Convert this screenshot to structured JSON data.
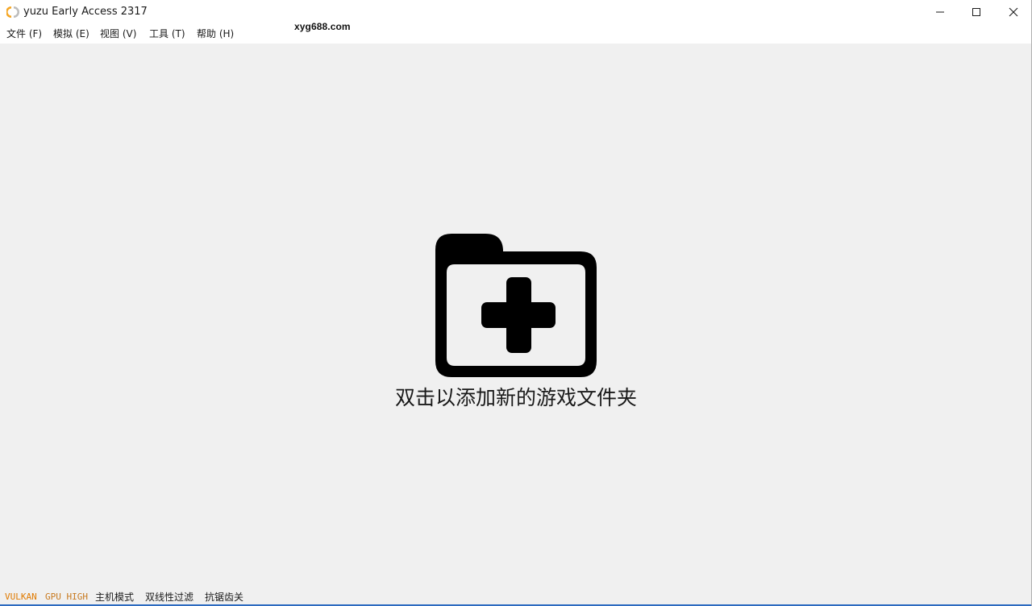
{
  "window": {
    "title": "yuzu Early Access 2317",
    "icon": "yuzu-logo-icon"
  },
  "window_controls": {
    "minimize_icon": "minimize-icon",
    "maximize_icon": "maximize-icon",
    "close_icon": "close-icon"
  },
  "menu": {
    "items": [
      {
        "label": "文件 (F)"
      },
      {
        "label": "模拟 (E)"
      },
      {
        "label": "视图 (V)"
      },
      {
        "label": "工具 (T)"
      },
      {
        "label": "帮助 (H)"
      }
    ]
  },
  "watermark": "xyg688.com",
  "main": {
    "icon": "folder-plus-icon",
    "placeholder_text": "双击以添加新的游戏文件夹"
  },
  "statusbar": {
    "renderer": "VULKAN",
    "gpu_accuracy": "GPU HIGH",
    "dock_mode": "主机模式",
    "filter": "双线性过滤",
    "anti_aliasing": "抗锯齿关"
  },
  "colors": {
    "renderer_label": "#e07a00",
    "gpu_label": "#c87a20",
    "background": "#f0f0f0",
    "accent_border": "#2d6bc0"
  }
}
